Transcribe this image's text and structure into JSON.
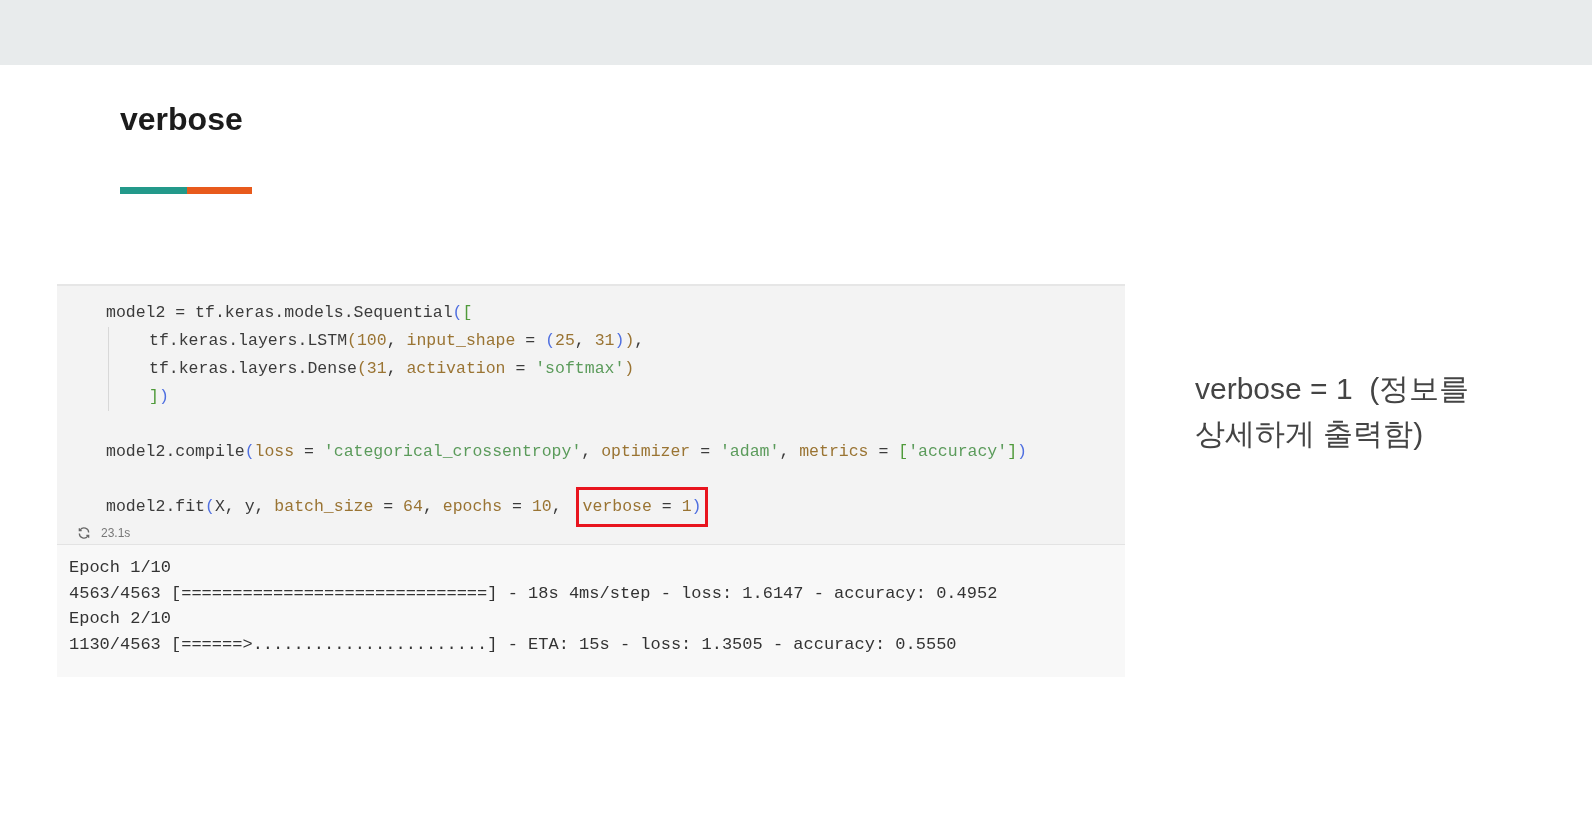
{
  "slide": {
    "title": "verbose"
  },
  "code_cell": {
    "statements": [
      {
        "tokens": [
          {
            "text": "model2 = tf.keras.models.Sequential",
            "kind": "plain"
          },
          {
            "text": "(",
            "kind": "bracket1"
          },
          {
            "text": "[",
            "kind": "bracket2"
          }
        ],
        "children": [
          {
            "tokens": [
              {
                "text": "tf.keras.layers.LSTM",
                "kind": "plain"
              },
              {
                "text": "(",
                "kind": "bracket3"
              },
              {
                "text": "100",
                "kind": "number"
              },
              {
                "text": ", ",
                "kind": "plain"
              },
              {
                "text": "input_shape",
                "kind": "param"
              },
              {
                "text": " = ",
                "kind": "plain"
              },
              {
                "text": "(",
                "kind": "bracket1"
              },
              {
                "text": "25",
                "kind": "number"
              },
              {
                "text": ", ",
                "kind": "plain"
              },
              {
                "text": "31",
                "kind": "number"
              },
              {
                "text": ")",
                "kind": "bracket1"
              },
              {
                "text": ")",
                "kind": "bracket3"
              },
              {
                "text": ",",
                "kind": "plain"
              }
            ]
          },
          {
            "tokens": [
              {
                "text": "tf.keras.layers.Dense",
                "kind": "plain"
              },
              {
                "text": "(",
                "kind": "bracket3"
              },
              {
                "text": "31",
                "kind": "number"
              },
              {
                "text": ", ",
                "kind": "plain"
              },
              {
                "text": "activation",
                "kind": "param"
              },
              {
                "text": " = ",
                "kind": "plain"
              },
              {
                "text": "'softmax'",
                "kind": "string"
              },
              {
                "text": ")",
                "kind": "bracket3"
              }
            ]
          },
          {
            "tokens": [
              {
                "text": "]",
                "kind": "bracket2"
              },
              {
                "text": ")",
                "kind": "bracket1"
              }
            ]
          }
        ]
      },
      {
        "tokens": [
          {
            "text": "model2.compile",
            "kind": "plain"
          },
          {
            "text": "(",
            "kind": "bracket1"
          },
          {
            "text": "loss",
            "kind": "param"
          },
          {
            "text": " = ",
            "kind": "plain"
          },
          {
            "text": "'categorical_crossentropy'",
            "kind": "string"
          },
          {
            "text": ", ",
            "kind": "plain"
          },
          {
            "text": "optimizer",
            "kind": "param"
          },
          {
            "text": " = ",
            "kind": "plain"
          },
          {
            "text": "'adam'",
            "kind": "string"
          },
          {
            "text": ", ",
            "kind": "plain"
          },
          {
            "text": "metrics",
            "kind": "param"
          },
          {
            "text": " = ",
            "kind": "plain"
          },
          {
            "text": "[",
            "kind": "bracket2"
          },
          {
            "text": "'accuracy'",
            "kind": "string"
          },
          {
            "text": "]",
            "kind": "bracket2"
          },
          {
            "text": ")",
            "kind": "bracket1"
          }
        ]
      },
      {
        "tokens": [
          {
            "text": "model2.fit",
            "kind": "plain"
          },
          {
            "text": "(",
            "kind": "bracket1"
          },
          {
            "text": "X, y, ",
            "kind": "plain"
          },
          {
            "text": "batch_size",
            "kind": "param"
          },
          {
            "text": " = ",
            "kind": "plain"
          },
          {
            "text": "64",
            "kind": "number"
          },
          {
            "text": ", ",
            "kind": "plain"
          },
          {
            "text": "epochs",
            "kind": "param"
          },
          {
            "text": " = ",
            "kind": "plain"
          },
          {
            "text": "10",
            "kind": "number"
          },
          {
            "text": ",",
            "kind": "plain"
          }
        ],
        "boxed_tokens": [
          {
            "text": "verbose",
            "kind": "param"
          },
          {
            "text": " = ",
            "kind": "plain"
          },
          {
            "text": "1",
            "kind": "number"
          },
          {
            "text": ")",
            "kind": "bracket1"
          }
        ]
      }
    ],
    "duration": "23.1s",
    "output": [
      "Epoch 1/10",
      "4563/4563 [==============================] - 18s 4ms/step - loss: 1.6147 - accuracy: 0.4952",
      "Epoch 2/10",
      "1130/4563 [======>.......................] - ETA: 15s - loss: 1.3505 - accuracy: 0.5550"
    ]
  },
  "note": "verbose = 1  (정보를 상세하게 출력함)"
}
